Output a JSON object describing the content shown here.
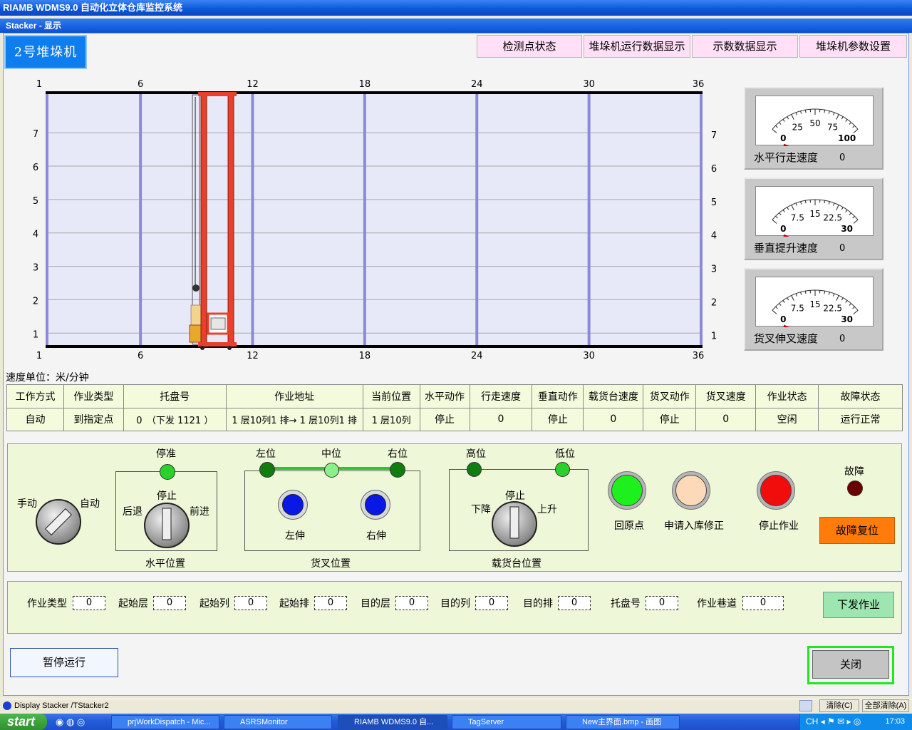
{
  "window": {
    "title": "RIAMB WDMS9.0 自动化立体仓库监控系统",
    "subtitle": "Stacker - 显示"
  },
  "stacker_title": "2号堆垛机",
  "top_buttons": [
    "检测点状态",
    "堆垛机运行数据显示",
    "示数数据显示",
    "堆垛机参数设置"
  ],
  "rack": {
    "top_ticks": [
      "1",
      "6",
      "12",
      "18",
      "24",
      "30",
      "36"
    ],
    "bottom_ticks": [
      "1",
      "6",
      "12",
      "18",
      "24",
      "30",
      "36"
    ],
    "left_levels": [
      "7",
      "6",
      "5",
      "4",
      "3",
      "2",
      "1"
    ],
    "right_levels": [
      "7",
      "6",
      "5",
      "4",
      "3",
      "2",
      "1"
    ],
    "columns": 36,
    "levels": 7,
    "stacker_column": 10,
    "stacker_level": 1,
    "colors": {
      "background": "#e8e9f8",
      "column_line": "#8c8ad8",
      "stacker": "#e8402a",
      "gridline": "#a8a8a8"
    }
  },
  "gauges": [
    {
      "label": "水平行走速度",
      "value": "0",
      "ticks": [
        "0",
        "25",
        "50",
        "75",
        "100"
      ],
      "needle": 0
    },
    {
      "label": "垂直提升速度",
      "value": "0",
      "ticks": [
        "0",
        "7.5",
        "15",
        "22.5",
        "30"
      ],
      "needle": 0
    },
    {
      "label": "货叉伸叉速度",
      "value": "0",
      "ticks": [
        "0",
        "7.5",
        "15",
        "22.5",
        "30"
      ],
      "needle": 0
    }
  ],
  "speed_unit": "速度单位：米/分钟",
  "status_table": {
    "headers": [
      "工作方式",
      "作业类型",
      "托盘号",
      "作业地址",
      "当前位置",
      "水平动作",
      "行走速度",
      "垂直动作",
      "载货台速度",
      "货叉动作",
      "货叉速度",
      "作业状态",
      "故障状态"
    ],
    "values": [
      "自动",
      "到指定点",
      "0　（下发 1121 ）",
      "1 层10列1 排→ 1 层10列1 排",
      "1 层10列",
      "停止",
      "0",
      "停止",
      "0",
      "停止",
      "0",
      "空闲",
      "运行正常"
    ]
  },
  "controls": {
    "mode_manual": "手动",
    "mode_auto": "自动",
    "horiz_stop_ready": "停准",
    "horiz_back": "后退",
    "horiz_stop": "停止",
    "horiz_forward": "前进",
    "horiz_title": "水平位置",
    "fork_left": "左位",
    "fork_mid": "中位",
    "fork_right": "右位",
    "fork_left_extend": "左伸",
    "fork_right_extend": "右伸",
    "fork_title": "货叉位置",
    "lift_high": "高位",
    "lift_low": "低位",
    "lift_down": "下降",
    "lift_stop": "停止",
    "lift_up": "上升",
    "lift_title": "载货台位置",
    "home": "回原点",
    "request_fix": "申请入库修正",
    "stop_job": "停止作业",
    "fault": "故障",
    "fault_reset": "故障复位"
  },
  "job_fields": [
    {
      "label": "作业类型",
      "value": "0"
    },
    {
      "label": "起始层",
      "value": "0"
    },
    {
      "label": "起始列",
      "value": "0"
    },
    {
      "label": "起始排",
      "value": "0"
    },
    {
      "label": "目的层",
      "value": "0"
    },
    {
      "label": "目的列",
      "value": "0"
    },
    {
      "label": "目的排",
      "value": "0"
    },
    {
      "label": "托盘号",
      "value": "0"
    },
    {
      "label": "作业巷道",
      "value": "0"
    }
  ],
  "send_job": "下发作业",
  "pause_run": "暂停运行",
  "close": "关闭",
  "statusbar": {
    "text": "Display Stacker /TStacker2",
    "clear": "清除(C)",
    "clear_all": "全部清除(A)"
  },
  "taskbar": {
    "start": "start",
    "tasks": [
      "prjWorkDispatch - Mic...",
      "ASRSMonitor",
      "RIAMB WDMS9.0 自...",
      "TagServer",
      "New主界面.bmp - 画图"
    ],
    "clock": "17:03"
  }
}
